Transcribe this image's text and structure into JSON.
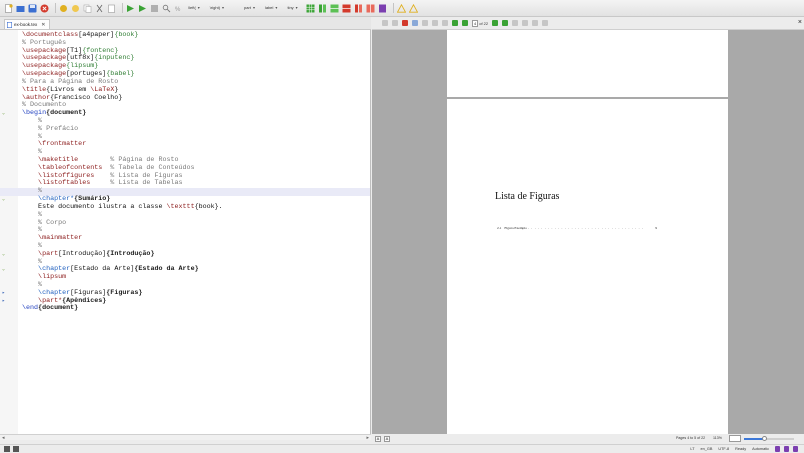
{
  "toolbar": {
    "combos": [
      {
        "label": "\\left(",
        "name": "left-delimiter-combo"
      },
      {
        "label": "\\right)",
        "name": "right-delimiter-combo"
      },
      {
        "label": "part",
        "name": "structure-combo"
      },
      {
        "label": "label",
        "name": "label-combo"
      },
      {
        "label": "tiny",
        "name": "size-combo"
      }
    ],
    "colors": {
      "green": "#3aa335",
      "blue": "#3b6fd1",
      "red": "#d33a2c",
      "yellow": "#e0b020",
      "purple": "#7b3fb0"
    }
  },
  "editor": {
    "tab_label": "ex-book.tex",
    "tab_close": "✕",
    "lines": [
      [
        {
          "c": "t-cmd",
          "t": "\\documentclass"
        },
        {
          "c": "t-plain",
          "t": "[a4paper]"
        },
        {
          "c": "t-arg",
          "t": "{book}"
        }
      ],
      [
        {
          "c": "t-cmt",
          "t": "% Português"
        }
      ],
      [
        {
          "c": "t-cmd",
          "t": "\\usepackage"
        },
        {
          "c": "t-plain",
          "t": "[T1]"
        },
        {
          "c": "t-arg",
          "t": "{fontenc}"
        }
      ],
      [
        {
          "c": "t-cmd",
          "t": "\\usepackage"
        },
        {
          "c": "t-plain",
          "t": "[utf8x]"
        },
        {
          "c": "t-arg",
          "t": "{inputenc}"
        }
      ],
      [
        {
          "c": "t-cmd",
          "t": "\\usepackage"
        },
        {
          "c": "t-arg",
          "t": "{lipsum}"
        }
      ],
      [
        {
          "c": "t-cmd",
          "t": "\\usepackage"
        },
        {
          "c": "t-plain",
          "t": "[portuges]"
        },
        {
          "c": "t-arg",
          "t": "{babel}"
        }
      ],
      [
        {
          "c": "t-cmt",
          "t": "% Para a Página de Rosto"
        }
      ],
      [
        {
          "c": "t-cmd",
          "t": "\\title"
        },
        {
          "c": "t-plain",
          "t": "{Livros em "
        },
        {
          "c": "t-cmd",
          "t": "\\LaTeX"
        },
        {
          "c": "t-plain",
          "t": "}"
        }
      ],
      [
        {
          "c": "t-cmd",
          "t": "\\author"
        },
        {
          "c": "t-plain",
          "t": "{Francisco Coelho}"
        }
      ],
      [
        {
          "c": "t-cmt",
          "t": "% Documento"
        }
      ],
      [
        {
          "c": "t-env",
          "t": "\\begin"
        },
        {
          "c": "t-env t-bold",
          "t": "{document}"
        }
      ],
      [
        {
          "c": "t-cmt",
          "t": "    %"
        }
      ],
      [
        {
          "c": "t-cmt",
          "t": "    % Prefácio"
        }
      ],
      [
        {
          "c": "t-cmt",
          "t": "    %"
        }
      ],
      [
        {
          "c": "t-cmd",
          "t": "    \\frontmatter"
        }
      ],
      [
        {
          "c": "t-cmt",
          "t": "    %"
        }
      ],
      [
        {
          "c": "t-cmd",
          "t": "    \\maketitle"
        },
        {
          "c": "t-cmt",
          "t": "        % Página de Rosto"
        }
      ],
      [
        {
          "c": "t-cmd",
          "t": "    \\tableofcontents"
        },
        {
          "c": "t-cmt",
          "t": "  % Tabela de Conteúdos"
        }
      ],
      [
        {
          "c": "t-cmd",
          "t": "    \\listoffigures"
        },
        {
          "c": "t-cmt",
          "t": "    % Lista de Figuras"
        }
      ],
      [
        {
          "c": "t-cmd",
          "t": "    \\listoftables"
        },
        {
          "c": "t-cmt",
          "t": "     % Lista de Tabelas"
        }
      ],
      [
        {
          "c": "t-cmt",
          "t": "    %"
        }
      ],
      [
        {
          "c": "t-chap",
          "t": "    \\chapter*"
        },
        {
          "c": "t-bold",
          "t": "{Sumário}"
        }
      ],
      [
        {
          "c": "t-plain",
          "t": "    Este documento ilustra a classe "
        },
        {
          "c": "t-cmd",
          "t": "\\texttt"
        },
        {
          "c": "t-plain",
          "t": "{book}."
        }
      ],
      [
        {
          "c": "t-cmt",
          "t": "    %"
        }
      ],
      [
        {
          "c": "t-cmt",
          "t": "    % Corpo"
        }
      ],
      [
        {
          "c": "t-cmt",
          "t": "    %"
        }
      ],
      [
        {
          "c": "t-cmd",
          "t": "    \\mainmatter"
        }
      ],
      [
        {
          "c": "t-cmt",
          "t": "    %"
        }
      ],
      [
        {
          "c": "t-cmd",
          "t": "    \\part"
        },
        {
          "c": "t-plain",
          "t": "[Introdução]"
        },
        {
          "c": "t-bold",
          "t": "{Introdução}"
        }
      ],
      [
        {
          "c": "t-cmt",
          "t": "    %"
        }
      ],
      [
        {
          "c": "t-chap",
          "t": "    \\chapter"
        },
        {
          "c": "t-plain",
          "t": "[Estado da Arte]"
        },
        {
          "c": "t-bold",
          "t": "{Estado da Arte}"
        }
      ],
      [
        {
          "c": "t-cmd",
          "t": "    \\lipsum"
        }
      ],
      [
        {
          "c": "t-cmt",
          "t": "    %"
        }
      ],
      [
        {
          "c": "t-chap",
          "t": "    \\chapter"
        },
        {
          "c": "t-plain",
          "t": "[Figuras]"
        },
        {
          "c": "t-bold",
          "t": "{Figuras}"
        }
      ],
      [
        {
          "c": "t-cmd",
          "t": "    \\part*"
        },
        {
          "c": "t-bold",
          "t": "{Apêndices}"
        }
      ],
      [
        {
          "c": "t-env",
          "t": "\\end"
        },
        {
          "c": "t-env t-bold",
          "t": "{document}"
        }
      ]
    ]
  },
  "preview": {
    "page_field": "4",
    "page_total": "of 22",
    "heading": "Lista de Figuras",
    "entry_number": "2.1",
    "entry_text": "Figura Exemplo",
    "entry_page": "9",
    "entry_dots": ". . . . . . . . . . . . . . . . . . . . . . . . . . . . . . . . . . .",
    "pages_label": "Pages 4 to 5 of 22",
    "zoom_label": "113%",
    "close_glyph": "×"
  },
  "status": {
    "language": "en_GB",
    "encoding": "UTF-8",
    "state": "Ready",
    "mode": "Automatic"
  }
}
